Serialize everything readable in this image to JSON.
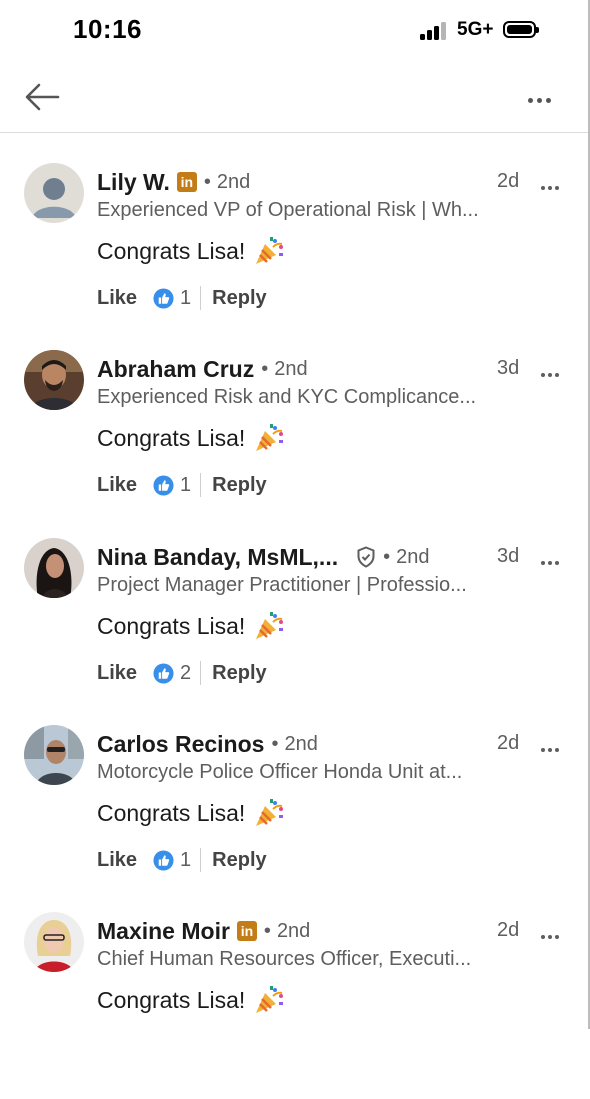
{
  "status_bar": {
    "time": "10:16",
    "network": "5G+",
    "icons": [
      "signal-icon",
      "battery-icon"
    ]
  },
  "nav": {
    "back_icon": "arrow-left-icon",
    "more_icon": "more-horizontal-icon"
  },
  "comments": [
    {
      "name": "Lily W.",
      "linkedin_badge": true,
      "badge_text": "in",
      "verified": false,
      "separator": "•",
      "degree": "2nd",
      "time": "2d",
      "headline": "Experienced VP of Operational Risk | Wh...",
      "text": "Congrats Lisa!",
      "like_label": "Like",
      "like_count": "1",
      "reply_label": "Reply"
    },
    {
      "name": "Abraham Cruz",
      "linkedin_badge": false,
      "verified": false,
      "separator": "•",
      "degree": "2nd",
      "time": "3d",
      "headline": "Experienced Risk and KYC Complicance...",
      "text": "Congrats Lisa!",
      "like_label": "Like",
      "like_count": "1",
      "reply_label": "Reply"
    },
    {
      "name": "Nina Banday, MsML,...",
      "linkedin_badge": false,
      "verified": true,
      "separator": "•",
      "degree": "2nd",
      "time": "3d",
      "headline": "Project Manager Practitioner | Professio...",
      "text": "Congrats Lisa!",
      "like_label": "Like",
      "like_count": "2",
      "reply_label": "Reply"
    },
    {
      "name": "Carlos Recinos",
      "linkedin_badge": false,
      "verified": false,
      "separator": "•",
      "degree": "2nd",
      "time": "2d",
      "headline": "Motorcycle Police Officer Honda Unit at...",
      "text": "Congrats Lisa!",
      "like_label": "Like",
      "like_count": "1",
      "reply_label": "Reply"
    },
    {
      "name": "Maxine Moir",
      "linkedin_badge": true,
      "badge_text": "in",
      "verified": false,
      "separator": "•",
      "degree": "2nd",
      "time": "2d",
      "headline": "Chief Human Resources Officer, Executi...",
      "text": "Congrats Lisa!",
      "like_label": "",
      "like_count": "",
      "reply_label": ""
    }
  ],
  "colors": {
    "like_blue": "#378fe9",
    "badge_gold": "#c37d16",
    "muted_text": "#5e5e5e"
  }
}
